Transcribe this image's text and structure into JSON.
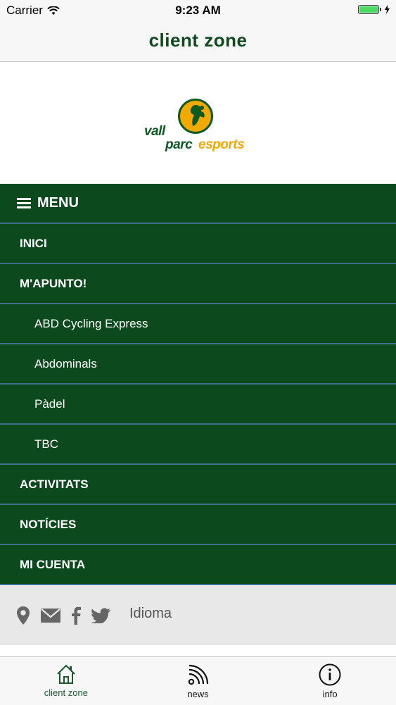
{
  "status_bar": {
    "carrier": "Carrier",
    "time": "9:23 AM"
  },
  "nav": {
    "title": "client zone"
  },
  "logo": {
    "word_vall": "vall",
    "word_parc": "parc",
    "word_esports": "esports",
    "colors": {
      "green": "#0f5a22",
      "orange": "#f2a900"
    }
  },
  "menu": {
    "header_label": "MENU",
    "items": [
      {
        "label": "INICI",
        "level": "top"
      },
      {
        "label": "M'APUNTO!",
        "level": "top"
      },
      {
        "label": "ABD Cycling Express",
        "level": "sub"
      },
      {
        "label": "Abdominals",
        "level": "sub"
      },
      {
        "label": "Pàdel",
        "level": "sub"
      },
      {
        "label": "TBC",
        "level": "sub"
      },
      {
        "label": "ACTIVITATS",
        "level": "top"
      },
      {
        "label": "NOTÍCIES",
        "level": "top"
      },
      {
        "label": "MI CUENTA",
        "level": "top"
      }
    ],
    "colors": {
      "background": "#0c4a1d",
      "divider": "#3f6f8c"
    }
  },
  "footer": {
    "icons": [
      "location-pin-icon",
      "mail-icon",
      "facebook-icon",
      "twitter-icon"
    ],
    "language_label": "Idioma"
  },
  "tab_bar": {
    "tabs": [
      {
        "label": "client zone",
        "icon": "home-icon",
        "active": true
      },
      {
        "label": "news",
        "icon": "rss-icon",
        "active": false
      },
      {
        "label": "info",
        "icon": "info-icon",
        "active": false
      }
    ],
    "active_color": "#1c5a2e"
  }
}
